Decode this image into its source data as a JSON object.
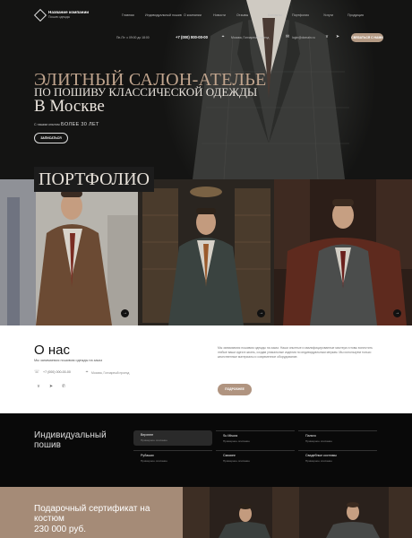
{
  "header": {
    "company_name": "Название компании",
    "company_sub": "Пошив одежды",
    "nav": [
      "Главная",
      "Индивидуальный пошив",
      "О компании",
      "Новости",
      "Отзывы",
      "Контакты",
      "Портфолио",
      "Услуги",
      "Продукция"
    ],
    "hours": "Пн-Пт: с 09:00 до 18:00",
    "phone": "+7 (000) 000-00-00",
    "address": "Москва, Гончарный проезд",
    "email": "login@domain.ru",
    "contact_button": "СВЯЗАТЬСЯ С НАМИ"
  },
  "hero": {
    "line1": "ЭЛИТНЫЙ САЛОН-АТЕЛЬЕ",
    "line2": "ПО ПОШИВУ КЛАССИЧЕСКОЙ ОДЕЖДЫ",
    "line3": "В Москве",
    "since_small": "С нашим опытом",
    "since_big": "БОЛЕЕ 30 ЛЕТ",
    "signup_button": "ЗАПИСАТЬСЯ"
  },
  "portfolio": {
    "title": "ПОРТФОЛИО",
    "arrow": "→"
  },
  "about": {
    "title": "О нас",
    "subtitle": "Мы занимаемся пошивом одежды на заказ",
    "phone": "+7 (000) 000-00-00",
    "address": "Москва, Гончарный проезд",
    "text": "Мы занимаемся пошивом одежды на заказ. Наши опытные и квалифицированные мастера готовы воплотить любые ваши идеи в жизнь, создав уникальные изделия по индивидуальным меркам. Мы используем только качественные материалы и современное оборудование.",
    "more_button": "ПОДРОБНЕЕ"
  },
  "tailoring": {
    "title": "Индивидуальный пошив",
    "services": [
      {
        "name": "Верхнее",
        "sub": "Примерное описание"
      },
      {
        "name": "Su Misura",
        "sub": "Примерное описание"
      },
      {
        "name": "Пальто",
        "sub": "Примерное описание"
      },
      {
        "name": "Рубашки",
        "sub": "Примерное описание"
      },
      {
        "name": "Смокинг",
        "sub": "Примерное описание"
      },
      {
        "name": "Свадебные костюмы",
        "sub": "Примерное описание"
      }
    ]
  },
  "certificate": {
    "title": "Подарочный сертификат на костюм",
    "price": "230 000 руб."
  },
  "colors": {
    "accent": "#b49a84",
    "hero_gold": "#c1a58e",
    "dark": "#090909",
    "cert_bg": "#a58b77"
  }
}
